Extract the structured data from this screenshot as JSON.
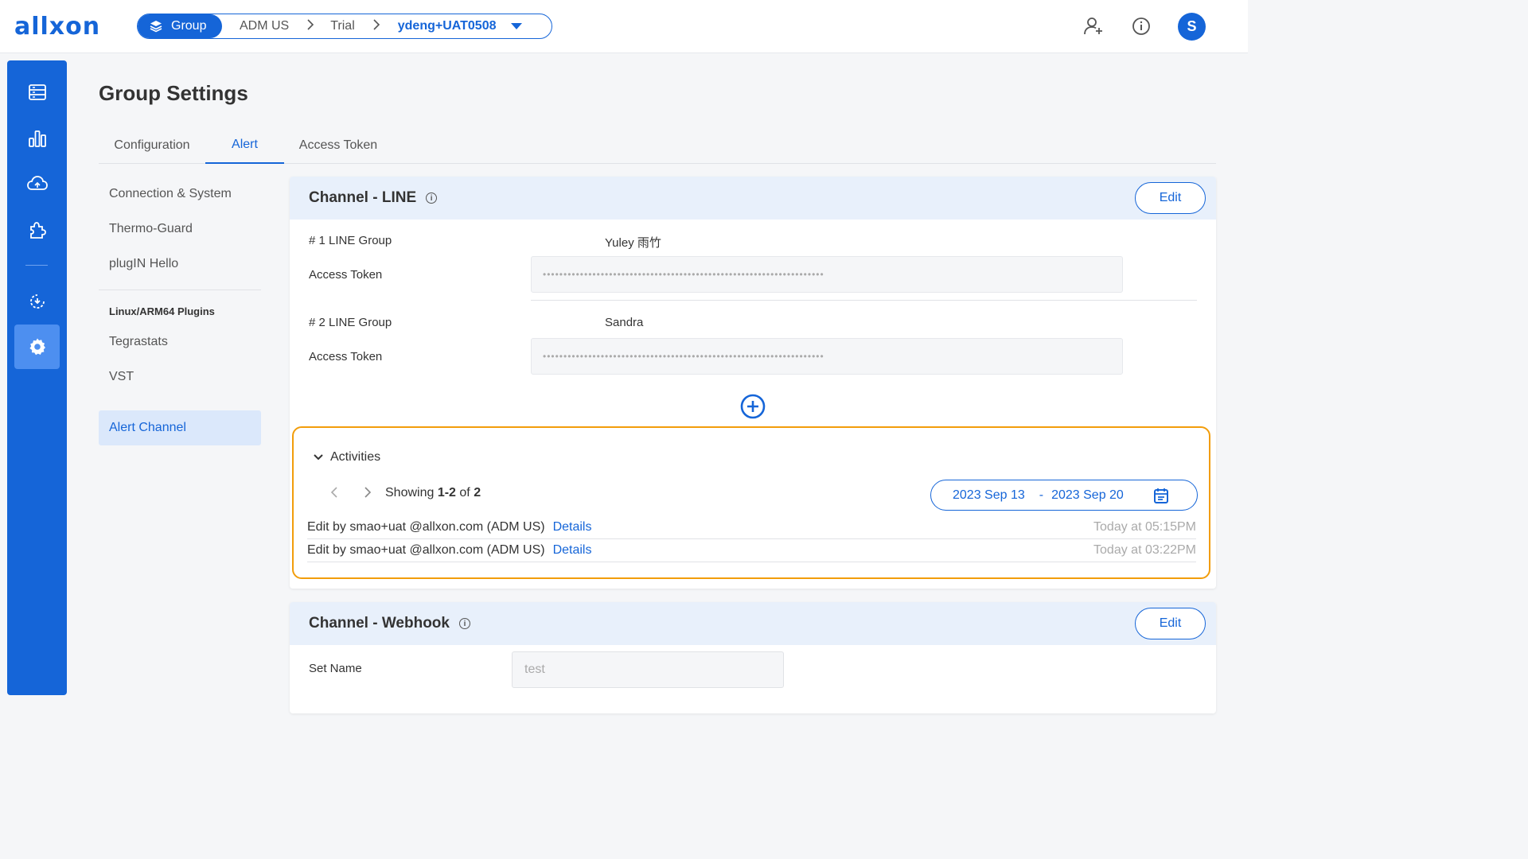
{
  "app": {
    "logo": "allxon"
  },
  "breadcrumb": {
    "group_label": "Group",
    "items": [
      "ADM US",
      "Trial"
    ],
    "current": "ydeng+UAT0508"
  },
  "user": {
    "avatar_initial": "S"
  },
  "page": {
    "title": "Group Settings"
  },
  "tabs": [
    {
      "label": "Configuration",
      "active": false
    },
    {
      "label": "Alert",
      "active": true
    },
    {
      "label": "Access Token",
      "active": false
    }
  ],
  "subnav": {
    "items": [
      "Connection & System",
      "Thermo-Guard",
      "plugIN Hello"
    ],
    "plugins_header": "Linux/ARM64 Plugins",
    "plugin_items": [
      "Tegrastats",
      "VST"
    ],
    "active_item": "Alert Channel"
  },
  "line_channel": {
    "title": "Channel - LINE",
    "edit_label": "Edit",
    "groups": [
      {
        "label": "# 1 LINE Group",
        "name": "Yuley 雨竹",
        "token_label": "Access Token",
        "token_value": "••••••••••••••••••••••••••••••••••••••••••••••••••••••••••••••••••••"
      },
      {
        "label": "# 2 LINE Group",
        "name": "Sandra",
        "token_label": "Access Token",
        "token_value": "••••••••••••••••••••••••••••••••••••••••••••••••••••••••••••••••••••"
      }
    ],
    "activities": {
      "title": "Activities",
      "showing_prefix": "Showing",
      "showing_range": "1-2",
      "showing_of": "of",
      "showing_total": "2",
      "date_from": "2023 Sep 13",
      "date_sep": "-",
      "date_to": "2023 Sep 20",
      "rows": [
        {
          "text": "Edit by smao+uat @allxon.com (ADM US)",
          "link": "Details",
          "time": "Today at 05:15PM"
        },
        {
          "text": "Edit by smao+uat @allxon.com (ADM US)",
          "link": "Details",
          "time": "Today at 03:22PM"
        }
      ]
    }
  },
  "webhook_channel": {
    "title": "Channel - Webhook",
    "edit_label": "Edit",
    "set_name_label": "Set Name",
    "set_name_value": "test"
  },
  "colors": {
    "accent": "#1565d8",
    "highlight": "#f29d0b"
  }
}
